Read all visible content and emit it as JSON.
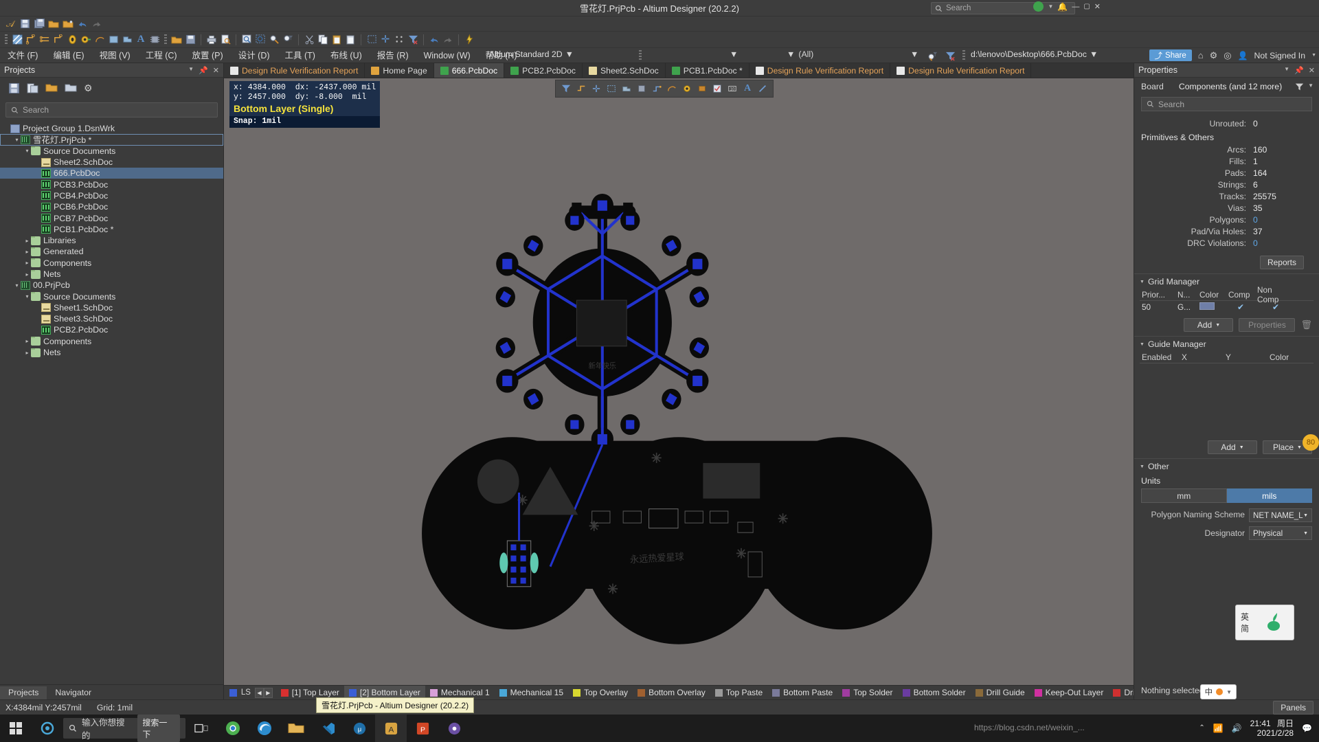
{
  "window": {
    "title": "雪花灯.PrjPcb - Altium Designer (20.2.2)",
    "search_placeholder": "Search",
    "share_label": "Share",
    "signin_label": "Not Signed In"
  },
  "menubar": {
    "items": [
      {
        "label": "文件 (F)"
      },
      {
        "label": "编辑 (E)"
      },
      {
        "label": "视图 (V)"
      },
      {
        "label": "工程 (C)"
      },
      {
        "label": "放置 (P)"
      },
      {
        "label": "设计 (D)"
      },
      {
        "label": "工具 (T)"
      },
      {
        "label": "布线 (U)"
      },
      {
        "label": "报告 (R)"
      },
      {
        "label": "Window (W)"
      },
      {
        "label": "帮助 (H)"
      }
    ],
    "view_config": "Altium Standard 2D",
    "all_filter": "(All)",
    "file_path": "d:\\lenovo\\Desktop\\666.PcbDoc"
  },
  "projects_panel": {
    "title": "Projects",
    "search_placeholder": "Search",
    "tabs": [
      {
        "label": "Projects",
        "active": true
      },
      {
        "label": "Navigator",
        "active": false
      }
    ],
    "tree": [
      {
        "label": "Project Group 1.DsnWrk",
        "indent": 0,
        "icon": "group-icon",
        "twisty": "",
        "state": "normal"
      },
      {
        "label": "雪花灯.PrjPcb *",
        "indent": 1,
        "icon": "project-icon",
        "twisty": "▾",
        "state": "outlined"
      },
      {
        "label": "Source Documents",
        "indent": 2,
        "icon": "folder-icon",
        "twisty": "▾",
        "state": "normal"
      },
      {
        "label": "Sheet2.SchDoc",
        "indent": 3,
        "icon": "sch-icon",
        "twisty": "",
        "state": "normal"
      },
      {
        "label": "666.PcbDoc",
        "indent": 3,
        "icon": "pcb-icon",
        "twisty": "",
        "state": "selected"
      },
      {
        "label": "PCB3.PcbDoc",
        "indent": 3,
        "icon": "pcb-icon",
        "twisty": "",
        "state": "normal"
      },
      {
        "label": "PCB4.PcbDoc",
        "indent": 3,
        "icon": "pcb-icon",
        "twisty": "",
        "state": "normal"
      },
      {
        "label": "PCB6.PcbDoc",
        "indent": 3,
        "icon": "pcb-icon",
        "twisty": "",
        "state": "normal"
      },
      {
        "label": "PCB7.PcbDoc",
        "indent": 3,
        "icon": "pcb-icon",
        "twisty": "",
        "state": "normal"
      },
      {
        "label": "PCB1.PcbDoc *",
        "indent": 3,
        "icon": "pcb-icon",
        "twisty": "",
        "state": "normal"
      },
      {
        "label": "Libraries",
        "indent": 2,
        "icon": "folder-icon",
        "twisty": "▸",
        "state": "normal"
      },
      {
        "label": "Generated",
        "indent": 2,
        "icon": "folder-icon",
        "twisty": "▸",
        "state": "normal"
      },
      {
        "label": "Components",
        "indent": 2,
        "icon": "folder-icon",
        "twisty": "▸",
        "state": "normal"
      },
      {
        "label": "Nets",
        "indent": 2,
        "icon": "folder-icon",
        "twisty": "▸",
        "state": "normal"
      },
      {
        "label": "00.PrjPcb",
        "indent": 1,
        "icon": "project-icon",
        "twisty": "▾",
        "state": "normal"
      },
      {
        "label": "Source Documents",
        "indent": 2,
        "icon": "folder-icon",
        "twisty": "▾",
        "state": "normal"
      },
      {
        "label": "Sheet1.SchDoc",
        "indent": 3,
        "icon": "sch-icon",
        "twisty": "",
        "state": "normal"
      },
      {
        "label": "Sheet3.SchDoc",
        "indent": 3,
        "icon": "sch-icon",
        "twisty": "",
        "state": "normal"
      },
      {
        "label": "PCB2.PcbDoc",
        "indent": 3,
        "icon": "pcb-icon",
        "twisty": "",
        "state": "normal"
      },
      {
        "label": "Components",
        "indent": 2,
        "icon": "folder-icon",
        "twisty": "▸",
        "state": "normal"
      },
      {
        "label": "Nets",
        "indent": 2,
        "icon": "folder-icon",
        "twisty": "▸",
        "state": "normal"
      }
    ]
  },
  "doc_tabs": [
    {
      "label": "Design Rule Verification Report",
      "active": false,
      "icon": "report-icon"
    },
    {
      "label": "Home Page",
      "active": false,
      "icon": "home-icon"
    },
    {
      "label": "666.PcbDoc",
      "active": true,
      "icon": "pcb-icon"
    },
    {
      "label": "PCB2.PcbDoc",
      "active": false,
      "icon": "pcb-icon"
    },
    {
      "label": "Sheet2.SchDoc",
      "active": false,
      "icon": "sch-icon"
    },
    {
      "label": "PCB1.PcbDoc *",
      "active": false,
      "icon": "pcb-icon"
    },
    {
      "label": "Design Rule Verification Report",
      "active": false,
      "icon": "report-icon"
    },
    {
      "label": "Design Rule Verification Report",
      "active": false,
      "icon": "report-icon"
    }
  ],
  "canvas_hud": {
    "x_label": "x:",
    "x_value": "4384.000",
    "dx_label": "dx:",
    "dx_value": "-2437.000",
    "x_unit": "mil",
    "y_label": "y:",
    "y_value": "2457.000",
    "dy_label": "dy:",
    "dy_value": "-8.000",
    "y_unit": "mil",
    "layer": "Bottom Layer (Single)",
    "snap": "Snap: 1mil"
  },
  "layer_bar": {
    "ls_label": "LS",
    "layers": [
      {
        "label": "[1] Top Layer",
        "color": "#d83030",
        "active": false
      },
      {
        "label": "[2] Bottom Layer",
        "color": "#3b5fd6",
        "active": true
      },
      {
        "label": "Mechanical 1",
        "color": "#d8a0d8",
        "active": false
      },
      {
        "label": "Mechanical 15",
        "color": "#4aa8d8",
        "active": false
      },
      {
        "label": "Top Overlay",
        "color": "#d8d830",
        "active": false
      },
      {
        "label": "Bottom Overlay",
        "color": "#a06030",
        "active": false
      },
      {
        "label": "Top Paste",
        "color": "#9a9a9a",
        "active": false
      },
      {
        "label": "Bottom Paste",
        "color": "#7a7a9a",
        "active": false
      },
      {
        "label": "Top Solder",
        "color": "#a03ca0",
        "active": false
      },
      {
        "label": "Bottom Solder",
        "color": "#6a3ca0",
        "active": false
      },
      {
        "label": "Drill Guide",
        "color": "#8a6a3a",
        "active": false
      },
      {
        "label": "Keep-Out Layer",
        "color": "#d030a0",
        "active": false
      },
      {
        "label": "Drill",
        "color": "#d03030",
        "active": false
      }
    ]
  },
  "properties_panel": {
    "title": "Properties",
    "board_label": "Board",
    "board_value": "Components (and 12 more)",
    "search_placeholder": "Search",
    "unrouted_label": "Unrouted:",
    "unrouted_value": "0",
    "section_primitives": "Primitives & Others",
    "stats": [
      {
        "label": "Arcs:",
        "value": "160",
        "blue": false
      },
      {
        "label": "Fills:",
        "value": "1",
        "blue": false
      },
      {
        "label": "Pads:",
        "value": "164",
        "blue": false
      },
      {
        "label": "Strings:",
        "value": "6",
        "blue": false
      },
      {
        "label": "Tracks:",
        "value": "25575",
        "blue": false
      },
      {
        "label": "Vias:",
        "value": "35",
        "blue": false
      },
      {
        "label": "Polygons:",
        "value": "0",
        "blue": true
      },
      {
        "label": "Pad/Via Holes:",
        "value": "37",
        "blue": false
      },
      {
        "label": "DRC Violations:",
        "value": "0",
        "blue": true
      }
    ],
    "reports_button": "Reports",
    "grid_manager": {
      "title": "Grid Manager",
      "columns": [
        "Prior...",
        "N...",
        "Color",
        "Comp",
        "Non Comp"
      ],
      "rows": [
        {
          "prior": "50",
          "name": "G...",
          "color": "#6f7fa8",
          "comp": "✔",
          "noncomp": "✔"
        }
      ],
      "add_button": "Add",
      "properties_button": "Properties"
    },
    "guide_manager": {
      "title": "Guide Manager",
      "columns": [
        "Enabled",
        "X",
        "Y",
        "Color"
      ],
      "rows": [],
      "add_button": "Add",
      "place_button": "Place"
    },
    "other": {
      "title": "Other",
      "units_label": "Units",
      "unit_options": [
        {
          "label": "mm",
          "selected": false
        },
        {
          "label": "mils",
          "selected": true
        }
      ],
      "polygon_naming_label": "Polygon Naming Scheme",
      "polygon_naming_value": "NET NAME_L",
      "designator_label": "Designator",
      "designator_value": "Physical"
    },
    "footer_status": "Nothing selected",
    "panels_button": "Panels"
  },
  "statusbar": {
    "coords": "X:4384mil Y:2457mil",
    "grid": "Grid: 1mil",
    "tooltip": "雪花灯.PrjPcb - Altium Designer (20.2.2)"
  },
  "taskbar": {
    "search_placeholder": "输入你想搜的",
    "search_chip": "搜索一下",
    "clock_time": "21:41",
    "clock_date": "周日",
    "clock_date2": "2021/2/28",
    "ime_keys": [
      "英",
      "简"
    ]
  },
  "watermark": "https://blog.csdn.net/weixin_...",
  "badge": "80",
  "colors": {
    "accent_blue": "#4d7aa8",
    "tab_active": "#4a4a4a",
    "panel_bg": "#3b3b3b",
    "canvas_bg": "#6f6b6a",
    "board_black": "#0a0a0a",
    "trace_blue": "#2233cc",
    "hud_bg": "#1d2f4a",
    "hud_yellow": "#f5e33c"
  }
}
